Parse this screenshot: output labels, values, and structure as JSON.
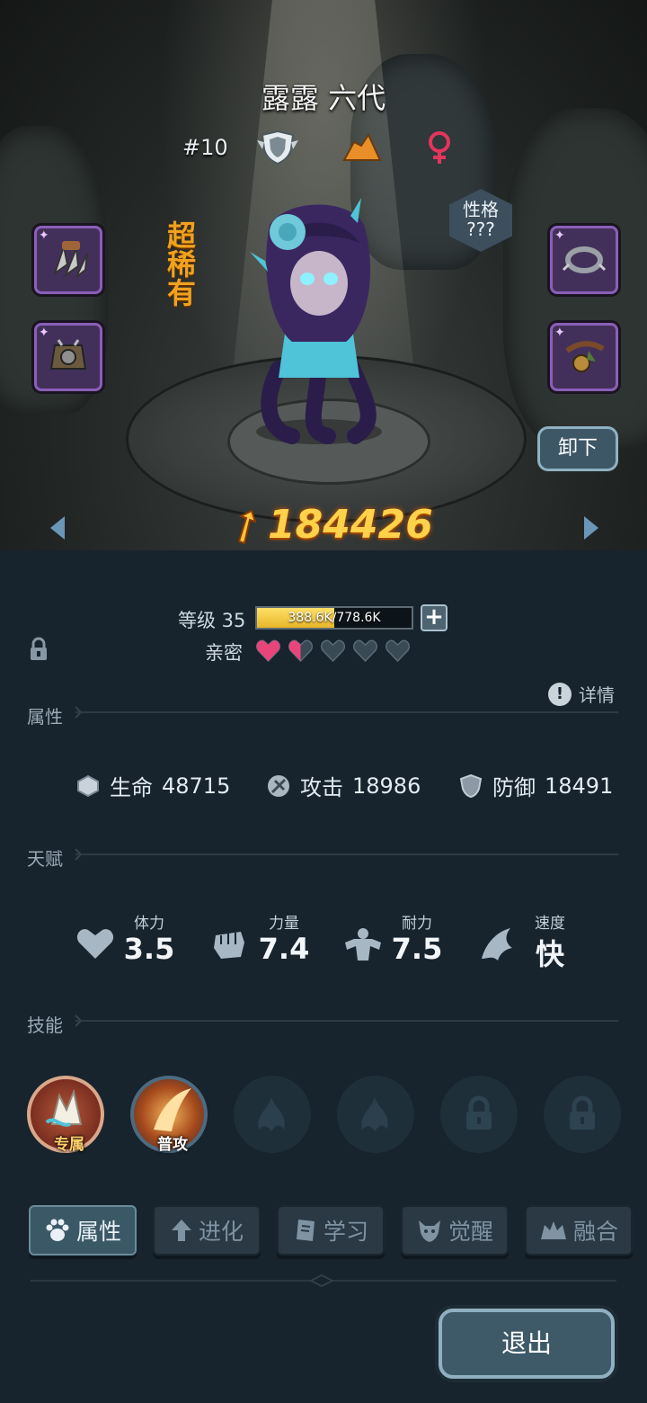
{
  "character": {
    "name": "露露 六代",
    "rank": "#10",
    "rarity": "超稀有",
    "trait_label": "性格",
    "trait_value": "???",
    "unload_label": "卸下",
    "power": "184426"
  },
  "level": {
    "label": "等级 35",
    "xp_text": "388.6K/778.6K",
    "xp_fraction": 0.499
  },
  "intimacy": {
    "label": "亲密",
    "hearts_filled": 1.5,
    "hearts_total": 5
  },
  "sections": {
    "attributes": "属性",
    "talent": "天赋",
    "skills": "技能",
    "details": "详情"
  },
  "stats": [
    {
      "label": "生命",
      "value": "48715",
      "icon": "hp-icon"
    },
    {
      "label": "攻击",
      "value": "18986",
      "icon": "attack-icon"
    },
    {
      "label": "防御",
      "value": "18491",
      "icon": "defense-icon"
    }
  ],
  "talents": [
    {
      "label": "体力",
      "value": "3.5",
      "icon": "heart-icon"
    },
    {
      "label": "力量",
      "value": "7.4",
      "icon": "fist-icon"
    },
    {
      "label": "耐力",
      "value": "7.5",
      "icon": "muscle-icon"
    },
    {
      "label": "速度",
      "value": "快",
      "icon": "wing-icon"
    }
  ],
  "skills": [
    {
      "tag": "专属",
      "state": "equipped"
    },
    {
      "tag": "普攻",
      "state": "equipped"
    },
    {
      "tag": "",
      "state": "empty"
    },
    {
      "tag": "",
      "state": "empty"
    },
    {
      "tag": "",
      "state": "locked"
    },
    {
      "tag": "",
      "state": "locked"
    }
  ],
  "tabs": [
    {
      "label": "属性",
      "icon": "paw-icon",
      "active": true
    },
    {
      "label": "进化",
      "icon": "evolve-icon",
      "active": false
    },
    {
      "label": "学习",
      "icon": "book-icon",
      "active": false
    },
    {
      "label": "觉醒",
      "icon": "awaken-icon",
      "active": false
    },
    {
      "label": "融合",
      "icon": "fusion-icon",
      "active": false
    }
  ],
  "exit_label": "退出",
  "colors": {
    "gold": "#ffd24a",
    "rarity_orange": "#f0a21e",
    "heart_pink": "#e8457a",
    "panel_bg": "#17232d"
  }
}
